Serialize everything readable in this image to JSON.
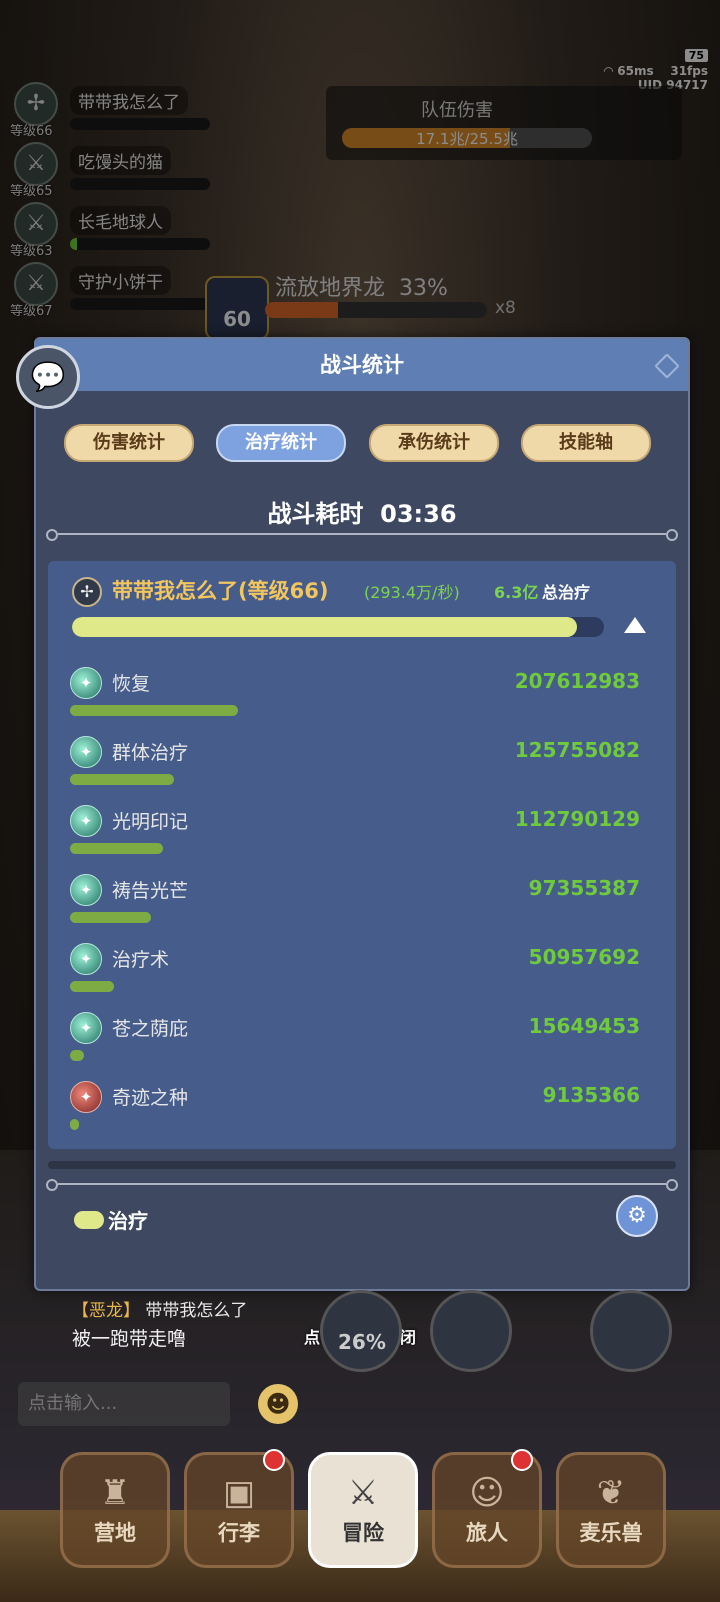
{
  "status": {
    "battery": "75",
    "ping": "65ms",
    "fps": "31fps",
    "uid": "UID  94717"
  },
  "team": [
    {
      "name": "带带我怎么了",
      "level": "等级66",
      "hp": 0,
      "icon": "✢"
    },
    {
      "name": "吃馒头的猫",
      "level": "等级65",
      "hp": 0,
      "icon": "⚔"
    },
    {
      "name": "长毛地球人",
      "level": "等级63",
      "hp": 5,
      "icon": "⚔"
    },
    {
      "name": "守护小饼干",
      "level": "等级67",
      "hp": 0,
      "icon": "⚔"
    }
  ],
  "team_damage": {
    "label": "队伍伤害",
    "value": "17.1兆/25.5兆",
    "fill": 0.67
  },
  "boss": {
    "name": "流放地界龙",
    "pct": "33%",
    "level": "60",
    "multiplier": "x8",
    "fill": 0.33
  },
  "dialog": {
    "title": "战斗统计",
    "tabs": [
      "伤害统计",
      "治疗统计",
      "承伤统计",
      "技能轴"
    ],
    "active_tab": 1,
    "duration_label": "战斗耗时",
    "duration": "03:36",
    "player": {
      "name": "带带我怎么了(等级66)",
      "rate": "(293.4万/秒)",
      "total": "6.3亿",
      "total_label": "总治疗",
      "fill": 0.95
    },
    "skills": [
      {
        "name": "恢复",
        "value": "207612983",
        "fill": 0.29,
        "icon": "heal"
      },
      {
        "name": "群体治疗",
        "value": "125755082",
        "fill": 0.18,
        "icon": "heal"
      },
      {
        "name": "光明印记",
        "value": "112790129",
        "fill": 0.16,
        "icon": "heal"
      },
      {
        "name": "祷告光芒",
        "value": "97355387",
        "fill": 0.14,
        "icon": "heal"
      },
      {
        "name": "治疗术",
        "value": "50957692",
        "fill": 0.075,
        "icon": "heal"
      },
      {
        "name": "苍之荫庇",
        "value": "15649453",
        "fill": 0.024,
        "icon": "heal"
      },
      {
        "name": "奇迹之种",
        "value": "9135366",
        "fill": 0.015,
        "icon": "red"
      }
    ],
    "legend": "治疗"
  },
  "chat": {
    "tag": "【恶龙】",
    "sender": "带带我怎么了",
    "message": "被一跑带走噜"
  },
  "close_hint": "点击空白处关闭",
  "input_placeholder": "点击输入...",
  "skill_cooldown": "26%",
  "nav": [
    {
      "label": "营地",
      "icon": "♜",
      "badge": false
    },
    {
      "label": "行李",
      "icon": "▣",
      "badge": true
    },
    {
      "label": "冒险",
      "icon": "⚔",
      "badge": false
    },
    {
      "label": "旅人",
      "icon": "☺",
      "badge": true
    },
    {
      "label": "麦乐兽",
      "icon": "❦",
      "badge": false
    }
  ],
  "nav_active": 2,
  "colors": {
    "header": "#5f7fb4",
    "panel": "#465d8c",
    "value_green": "#6fcb3c",
    "player_name": "#f3c55d",
    "bar": "#dfe98a"
  }
}
